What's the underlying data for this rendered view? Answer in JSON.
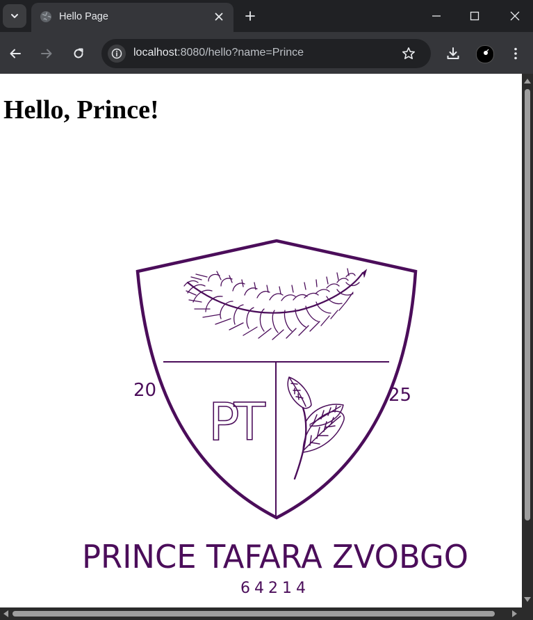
{
  "browser": {
    "tab": {
      "title": "Hello Page"
    },
    "address_bar": {
      "host": "localhost",
      "rest": ":8080/hello?name=Prince"
    }
  },
  "page": {
    "heading": "Hello, Prince!",
    "crest": {
      "year_left": "20",
      "year_right": "25",
      "monogram": "PT",
      "name": "PRINCE TAFARA ZVOBGO",
      "number": "64214",
      "color": "#4b0d5a"
    }
  },
  "icons": {
    "tab_search": "chevron-down-icon",
    "favicon": "globe-icon",
    "tab_close": "close-icon",
    "new_tab": "plus-icon",
    "back": "arrow-left-icon",
    "forward": "arrow-right-icon",
    "reload": "reload-icon",
    "site_info": "info-icon",
    "bookmark": "star-icon",
    "download": "download-icon",
    "menu": "kebab-menu-icon"
  }
}
